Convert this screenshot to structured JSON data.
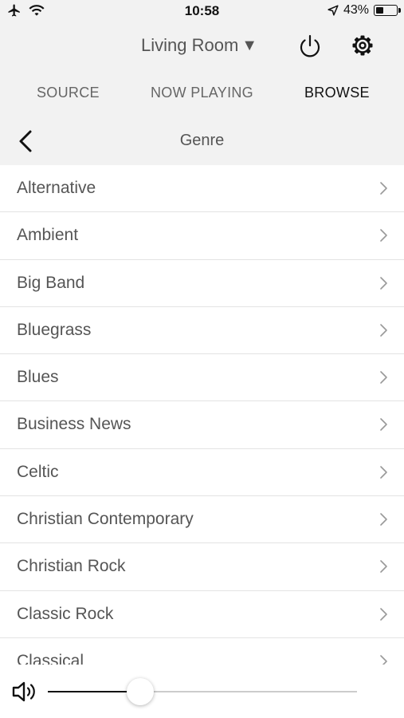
{
  "status_bar": {
    "time": "10:58",
    "battery": "43%",
    "battery_level": 0.43
  },
  "room": {
    "name": "Living Room",
    "caret": "▼"
  },
  "tabs": [
    {
      "label": "SOURCE",
      "active": false
    },
    {
      "label": "NOW PLAYING",
      "active": false
    },
    {
      "label": "BROWSE",
      "active": true
    }
  ],
  "nav": {
    "title": "Genre"
  },
  "genres": [
    "Alternative",
    "Ambient",
    "Big Band",
    "Bluegrass",
    "Blues",
    "Business News",
    "Celtic",
    "Christian Contemporary",
    "Christian Rock",
    "Classic Rock",
    "Classical"
  ],
  "volume": {
    "level": 0.3
  },
  "icons": {
    "airplane": "airplane-icon",
    "wifi": "wifi-icon",
    "location": "location-arrow-icon",
    "battery": "battery-icon",
    "power": "power-icon",
    "settings": "gear-icon",
    "back": "back-chevron-icon",
    "row": "chevron-right-icon",
    "volume": "speaker-icon"
  }
}
